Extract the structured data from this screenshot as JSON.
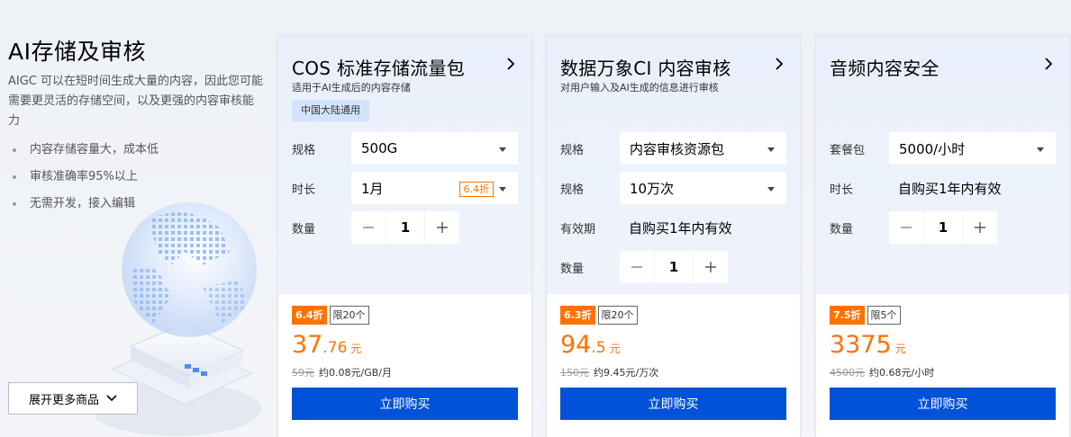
{
  "left": {
    "title": "AI存储及审核",
    "description": "AIGC 可以在短时间生成大量的内容，因此您可能需要更灵活的存储空间，以及更强的内容审核能力",
    "bullets": [
      "内容存储容量大，成本低",
      "审核准确率95%以上",
      "无需开发，接入编辑"
    ],
    "expand_button": "展开更多商品"
  },
  "cards": [
    {
      "title": "COS 标准存储流量包",
      "subtitle": "适用于AI生成后的内容存储",
      "region_tag": "中国大陆通用",
      "spec_label": "规格",
      "spec_value": "500G",
      "duration_label": "时长",
      "duration_value": "1月",
      "duration_discount": "6.4折",
      "qty_label": "数量",
      "qty_value": "1",
      "discount_badge": "6.4折",
      "limit_badge": "限20个",
      "price_int": "37",
      "price_dec": ".76",
      "price_unit": "元",
      "orig_price": "59元",
      "unit_price": "约0.08元/GB/月",
      "buy_label": "立即购买"
    },
    {
      "title": "数据万象CI 内容审核",
      "subtitle": "对用户输入及AI生成的信息进行审核",
      "spec1_label": "规格",
      "spec1_value": "内容审核资源包",
      "spec2_label": "规格",
      "spec2_value": "10万次",
      "valid_label": "有效期",
      "valid_value": "自购买1年内有效",
      "qty_label": "数量",
      "qty_value": "1",
      "discount_badge": "6.3折",
      "limit_badge": "限20个",
      "price_int": "94",
      "price_dec": ".5",
      "price_unit": "元",
      "orig_price": "150元",
      "unit_price": "约9.45元/万次",
      "buy_label": "立即购买"
    },
    {
      "title": "音频内容安全",
      "package_label": "套餐包",
      "package_value": "5000/小时",
      "duration_label": "时长",
      "duration_value": "自购买1年内有效",
      "qty_label": "数量",
      "qty_value": "1",
      "discount_badge": "7.5折",
      "limit_badge": "限5个",
      "price_int": "3375",
      "price_dec": "",
      "price_unit": "元",
      "orig_price": "4500元",
      "unit_price": "约0.68元/小时",
      "buy_label": "立即购买"
    }
  ],
  "icons": {
    "card_arrow": "chevron-right-icon",
    "select_caret": "caret-down-icon",
    "minus": "minus-icon",
    "plus": "plus-icon",
    "expand": "chevron-down-icon"
  },
  "colors": {
    "accent_orange": "#ff7200",
    "primary_blue": "#0052d9",
    "tag_blue": "#d4e3fc"
  }
}
